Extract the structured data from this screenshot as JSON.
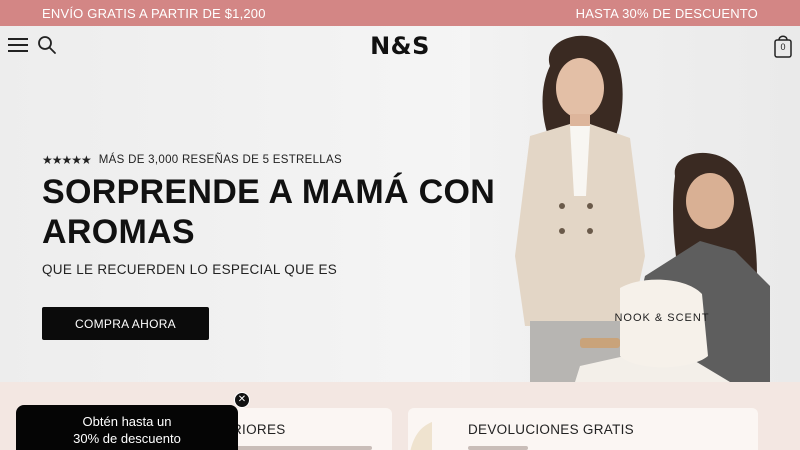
{
  "announcement": {
    "left": "ENVÍO GRATIS A PARTIR DE $1,200",
    "right": "HASTA 30% DE DESCUENTO",
    "bg_color": "#d38685"
  },
  "header": {
    "logo": "N&S",
    "cart_count": "0",
    "icons": [
      "menu-icon",
      "search-icon",
      "shopping-bag-icon"
    ]
  },
  "hero": {
    "stars": "★★★★★",
    "rating_text": "MÁS DE 3,000 RESEÑAS DE 5 ESTRELLAS",
    "headline": "SORPRENDE A MAMÁ CON AROMAS",
    "subheadline": "QUE LE RECUERDEN LO ESPECIAL QUE ES",
    "cta_label": "COMPRA AHORA",
    "bag_print": "NOOK & SCENT"
  },
  "features": {
    "left_title": "RIORES",
    "right_title": "DEVOLUCIONES GRATIS"
  },
  "promo": {
    "text_line1": "Obtén hasta un",
    "text_line2": "30% de descuento",
    "close_symbol": "✕"
  }
}
